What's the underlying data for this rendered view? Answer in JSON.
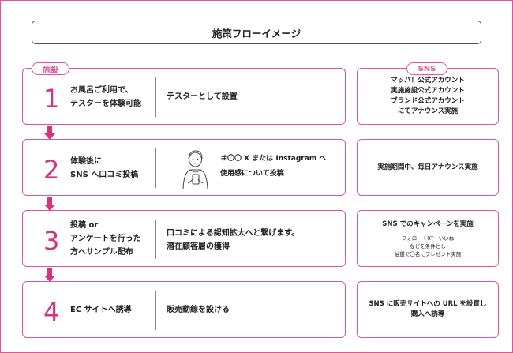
{
  "title": "施策フローイメージ",
  "tags": {
    "left": "施設",
    "right": "SNS"
  },
  "steps": [
    {
      "num": "1",
      "label": [
        "お風呂ご利用で、",
        "テスターを体験可能"
      ],
      "desc": [
        "テスターとして設置"
      ]
    },
    {
      "num": "2",
      "label": [
        "体験後に",
        "SNS へ口コミ投稿"
      ],
      "desc": [
        "＃〇〇 X または Instagram へ",
        "使用感について投稿"
      ]
    },
    {
      "num": "3",
      "label": [
        "投稿 or",
        "アンケートを行った",
        "方へサンプル配布"
      ],
      "desc": [
        "口コミによる認知拡大へと繋げます。",
        "潜在顧客層の獲得"
      ]
    },
    {
      "num": "4",
      "label": [
        "EC サイトへ誘導"
      ],
      "desc": [
        "販売動線を設ける"
      ]
    }
  ],
  "sns": [
    {
      "lines": [
        "マッパ！公式アカウント",
        "実施施設公式アカウント",
        "ブランド公式アカウント",
        "にてアナウンス実施"
      ],
      "small": []
    },
    {
      "lines": [
        "実施期間中、毎日アナウンス実施"
      ],
      "small": []
    },
    {
      "lines": [
        "SNS でのキャンペーンを実施"
      ],
      "small": [
        "フォロー＋RT＋いいね",
        "などを条件とし",
        "抽選で〇名にプレゼント実施"
      ]
    },
    {
      "lines": [
        "SNS に販売サイトへの URL を設置し",
        "購入へ誘導"
      ],
      "small": []
    }
  ],
  "colors": {
    "accent": "#e0559a",
    "number": "#d6337f"
  },
  "icons": {
    "person": "person-holding-phone-icon",
    "arrow": "down-arrow-icon"
  }
}
